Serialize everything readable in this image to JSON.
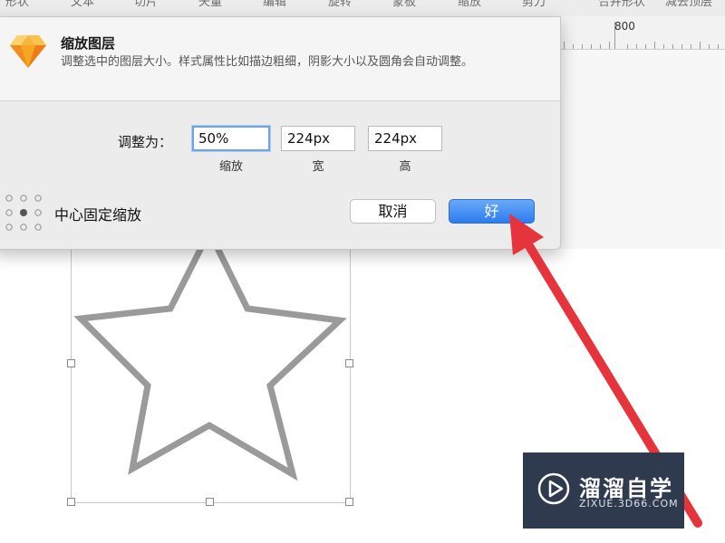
{
  "toolbar": {
    "items": [
      "形状",
      "文本",
      "切片",
      "矢量",
      "编辑",
      "旋转",
      "蒙板",
      "缩放",
      "剪刀",
      "合并形状",
      "减去顶层"
    ]
  },
  "ruler": {
    "label": "800"
  },
  "dialog": {
    "title": "缩放图层",
    "description": "调整选中的图层大小。样式属性比如描边粗细，阴影大小以及圆角会自动调整。",
    "resize_label": "调整为：",
    "fields": [
      {
        "value": "50%",
        "caption": "缩放"
      },
      {
        "value": "224px",
        "caption": "宽"
      },
      {
        "value": "224px",
        "caption": "高"
      }
    ],
    "center_label": "中心固定缩放",
    "cancel_label": "取消",
    "ok_label": "好"
  },
  "watermark": {
    "title": "溜溜自学",
    "subtitle": "ZIXUE.3D66.COM"
  },
  "colors": {
    "accent": "#2c7cf0",
    "arrow": "#e5343b",
    "star_stroke": "#9a9a9a",
    "watermark_bg": "#2f3a4f"
  },
  "icons": {
    "app": "sketch-diamond-icon",
    "anchor": "anchor-grid-icon",
    "watermark": "play-logo-icon"
  }
}
